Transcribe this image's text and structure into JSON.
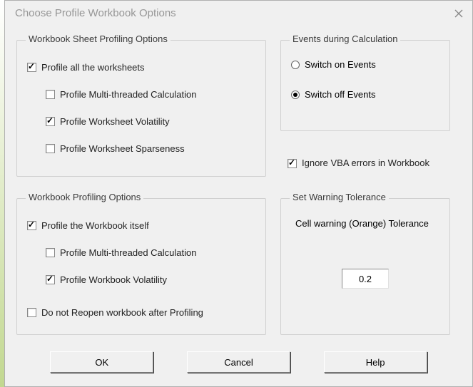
{
  "title": "Choose Profile Workbook Options",
  "groups": {
    "sheet": {
      "legend": "Workbook Sheet Profiling Options",
      "profile_all": {
        "label": "Profile all the worksheets",
        "checked": true
      },
      "multi": {
        "label": "Profile Multi-threaded Calculation",
        "checked": false
      },
      "volatility": {
        "label": "Profile Worksheet Volatility",
        "checked": true
      },
      "sparseness": {
        "label": "Profile Worksheet Sparseness",
        "checked": false
      }
    },
    "workbook": {
      "legend": "Workbook Profiling Options",
      "profile_itself": {
        "label": "Profile the Workbook itself",
        "checked": true
      },
      "multi": {
        "label": "Profile Multi-threaded Calculation",
        "checked": false
      },
      "volatility": {
        "label": "Profile Workbook Volatility",
        "checked": true
      },
      "no_reopen": {
        "label": "Do not Reopen workbook after Profiling",
        "checked": false
      }
    },
    "events": {
      "legend": "Events during Calculation",
      "on": {
        "label": "Switch on Events",
        "selected": false
      },
      "off": {
        "label": "Switch off Events",
        "selected": true
      }
    },
    "ignore_vba": {
      "label": "Ignore VBA errors in Workbook",
      "checked": true
    },
    "tolerance": {
      "legend": "Set Warning Tolerance",
      "label": "Cell warning (Orange) Tolerance",
      "value": "0.2"
    }
  },
  "buttons": {
    "ok": "OK",
    "cancel": "Cancel",
    "help": "Help"
  }
}
